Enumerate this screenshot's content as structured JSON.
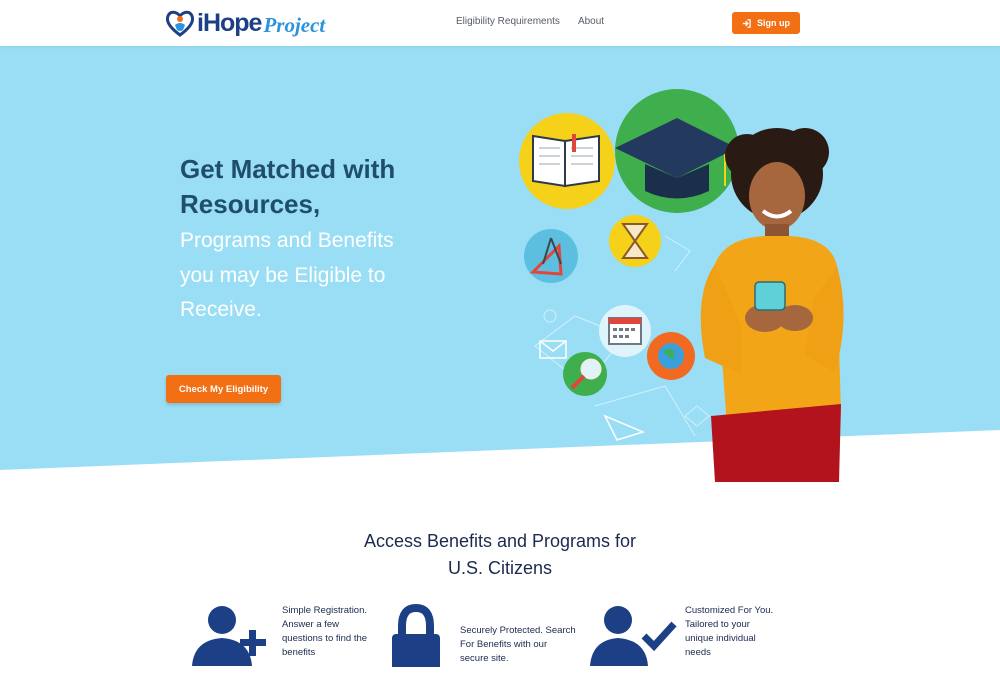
{
  "brand": {
    "logo_main": "iHope",
    "logo_sub": "Project",
    "accent": "#f36f14",
    "navy": "#1d3f86",
    "sky": "#99def5"
  },
  "nav": {
    "items": [
      "Eligibility Requirements",
      "About"
    ],
    "signup_label": "Sign up"
  },
  "hero": {
    "title_line1": "Get Matched with",
    "title_line2": "Resources,",
    "subtitle_line1": "Programs and Benefits",
    "subtitle_line2": "you may be Eligible to",
    "subtitle_line3": "Receive.",
    "cta_label": "Check My Eligibility"
  },
  "section": {
    "title_line1": "Access Benefits and Programs for",
    "title_line2": "U.S. Citizens",
    "features": [
      {
        "icon": "user-plus-icon",
        "text": "Simple Registration. Answer a few questions to find the benefits"
      },
      {
        "icon": "lock-icon",
        "text": "Securely Protected. Search For Benefits with our secure site."
      },
      {
        "icon": "user-check-icon",
        "text": "Customized For You. Tailored to your unique individual needs"
      }
    ]
  }
}
